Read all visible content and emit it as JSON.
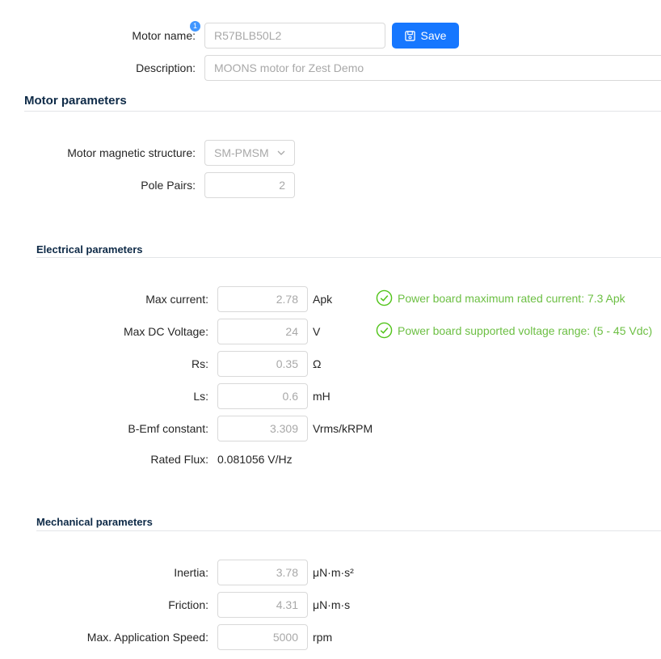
{
  "header": {
    "motor_name_label": "Motor name:",
    "motor_name_value": "R57BLB50L2",
    "badge_count": "1",
    "save_label": "Save",
    "description_label": "Description:",
    "description_value": "MOONS motor for Zest Demo"
  },
  "motor_parameters": {
    "title": "Motor parameters",
    "structure_label": "Motor magnetic structure:",
    "structure_value": "SM-PMSM",
    "pole_pairs_label": "Pole Pairs:",
    "pole_pairs_value": "2"
  },
  "electrical": {
    "title": "Electrical parameters",
    "max_current": {
      "label": "Max current:",
      "value": "2.78",
      "unit": "Apk",
      "status": "Power board maximum rated current: 7.3 Apk"
    },
    "max_dc_voltage": {
      "label": "Max DC Voltage:",
      "value": "24",
      "unit": "V",
      "status": "Power board supported voltage range: (5 - 45 Vdc)"
    },
    "rs": {
      "label": "Rs:",
      "value": "0.35",
      "unit": "Ω"
    },
    "ls": {
      "label": "Ls:",
      "value": "0.6",
      "unit": "mH"
    },
    "bemf": {
      "label": "B-Emf constant:",
      "value": "3.309",
      "unit": "Vrms/kRPM"
    },
    "rated_flux": {
      "label": "Rated Flux:",
      "value": "0.081056 V/Hz"
    }
  },
  "mechanical": {
    "title": "Mechanical parameters",
    "inertia": {
      "label": "Inertia:",
      "value": "3.78",
      "unit": "μN·m·s²"
    },
    "friction": {
      "label": "Friction:",
      "value": "4.31",
      "unit": "μN·m·s"
    },
    "max_speed": {
      "label": "Max. Application Speed:",
      "value": "5000",
      "unit": "rpm"
    }
  },
  "colors": {
    "accent": "#1677ff",
    "success": "#52c41a",
    "heading": "#0e2a47"
  }
}
